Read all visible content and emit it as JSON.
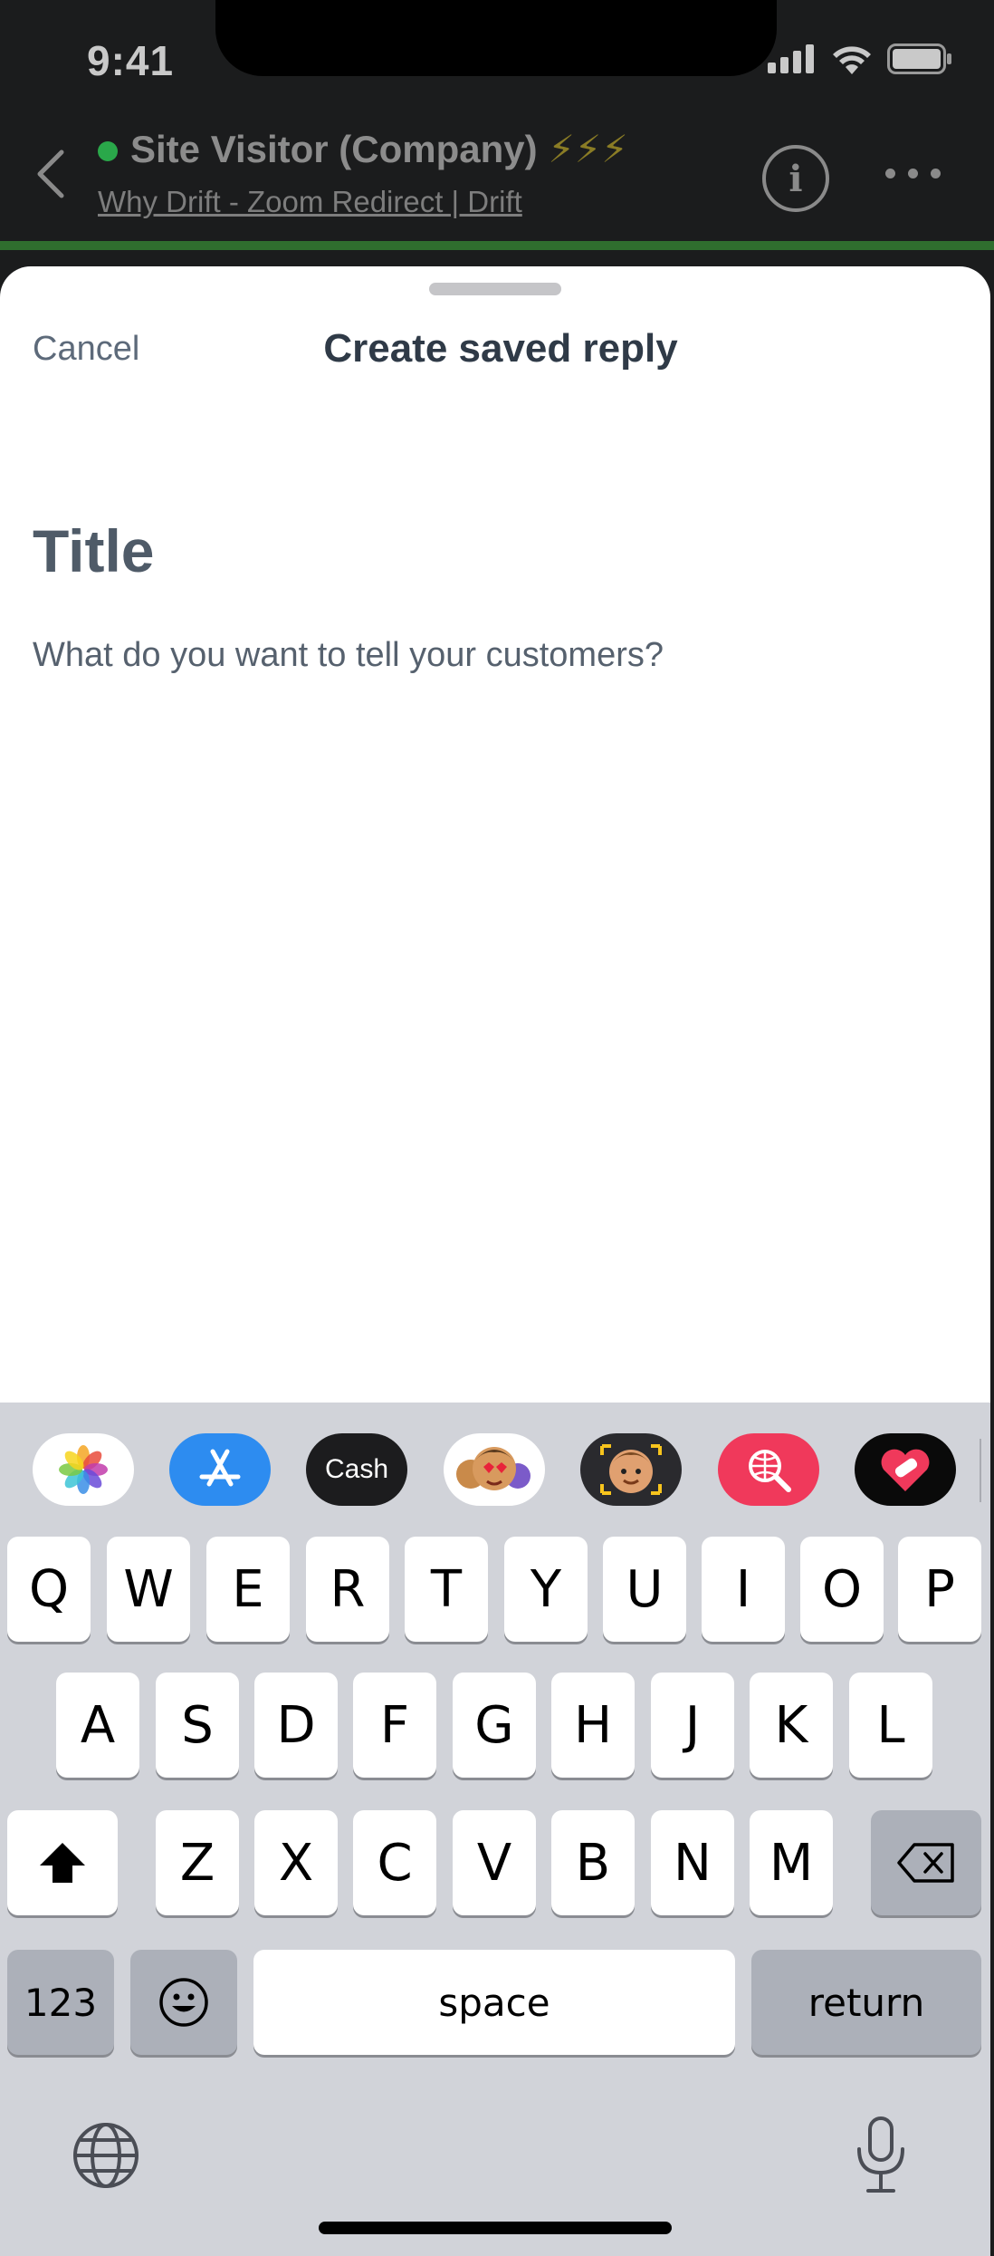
{
  "status_bar": {
    "time": "9:41"
  },
  "conversation": {
    "title": "Site Visitor (Company)",
    "title_suffix": "⚡⚡⚡",
    "subtitle": "Why Drift - Zoom Redirect | Drift",
    "info_glyph": "i",
    "online_color": "#2aa84a"
  },
  "sheet": {
    "cancel_label": "Cancel",
    "title": "Create saved reply",
    "title_placeholder": "Title",
    "body_placeholder": "What do you want to tell your customers?"
  },
  "keyboard": {
    "apps": [
      {
        "name": "photos-app-icon",
        "label": ""
      },
      {
        "name": "app-store-app-icon",
        "label": ""
      },
      {
        "name": "cash-app-icon",
        "label": "Cash"
      },
      {
        "name": "memoji-stickers-app-icon",
        "label": ""
      },
      {
        "name": "memoji-app-icon",
        "label": ""
      },
      {
        "name": "search-images-app-icon",
        "label": ""
      },
      {
        "name": "heart-stickers-app-icon",
        "label": ""
      }
    ],
    "row1": [
      "Q",
      "W",
      "E",
      "R",
      "T",
      "Y",
      "U",
      "I",
      "O",
      "P"
    ],
    "row2": [
      "A",
      "S",
      "D",
      "F",
      "G",
      "H",
      "J",
      "K",
      "L"
    ],
    "row3": [
      "Z",
      "X",
      "C",
      "V",
      "B",
      "N",
      "M"
    ],
    "numbers_label": "123",
    "space_label": "space",
    "return_label": "return"
  }
}
